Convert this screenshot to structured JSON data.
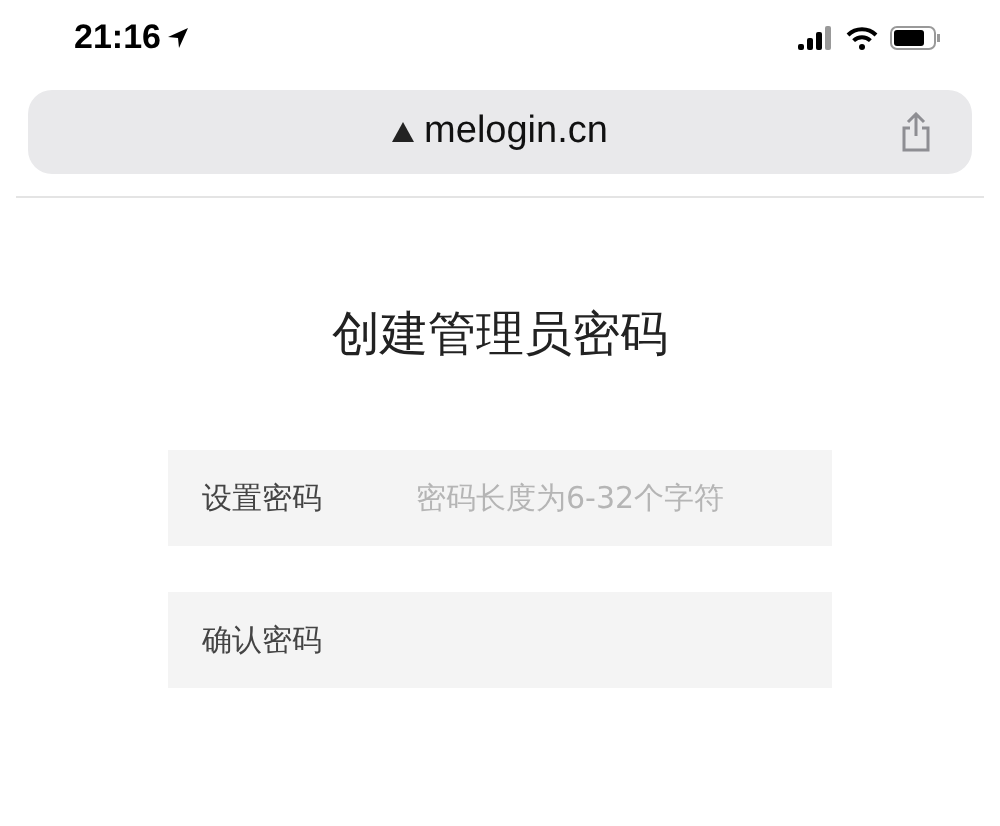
{
  "status_bar": {
    "time": "21:16"
  },
  "address_bar": {
    "url": "melogin.cn"
  },
  "page": {
    "title": "创建管理员密码",
    "fields": [
      {
        "label": "设置密码",
        "placeholder": "密码长度为6-32个字符"
      },
      {
        "label": "确认密码"
      }
    ]
  }
}
